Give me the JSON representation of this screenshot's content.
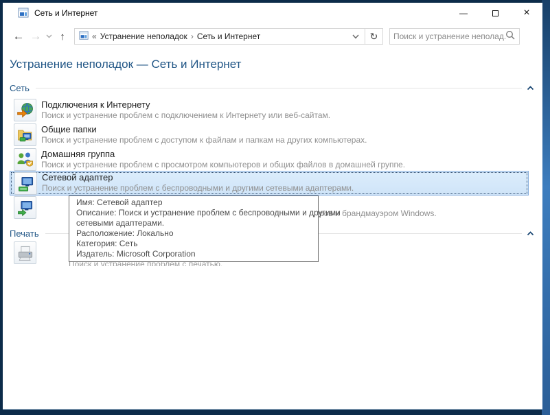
{
  "window": {
    "title": "Сеть и Интернет",
    "controls": {
      "minimize": "—",
      "close": "×"
    }
  },
  "navbar": {
    "back": "←",
    "forward": "→",
    "up": "↑",
    "refresh": "↻",
    "breadcrumb": {
      "collapse": "«",
      "separator": "›",
      "items": [
        "Устранение неполадок",
        "Сеть и Интернет"
      ]
    },
    "search_placeholder": "Поиск и устранение неполад..."
  },
  "page": {
    "title": "Устранение неполадок — Сеть и Интернет"
  },
  "sections": [
    {
      "label": "Сеть",
      "items": [
        {
          "title": "Подключения к Интернету",
          "description": "Поиск и устранение проблем с подключением к Интернету или веб-сайтам."
        },
        {
          "title": "Общие папки",
          "description": "Поиск и устранение проблем с доступом к файлам и папкам на других компьютерах."
        },
        {
          "title": "Домашняя группа",
          "description": "Поиск и устранение проблем с просмотром компьютеров и общих файлов в домашней группе."
        },
        {
          "title": "Сетевой адаптер",
          "description": "Поиск и устранение проблем с беспроводными и другими сетевыми адаптерами."
        },
        {
          "description_visible": "ров и брандмауэром Windows."
        }
      ]
    },
    {
      "label": "Печать",
      "items": [
        {
          "description_clipped": "Поиск и устранение проблем с печатью."
        }
      ]
    }
  ],
  "tooltip": {
    "lines": [
      "Имя: Сетевой адаптер",
      "Описание: Поиск и устранение проблем с беспроводными и другими",
      "сетевыми адаптерами.",
      "Расположение: Локально",
      "Категория: Сеть",
      "Издатель: Microsoft Corporation"
    ]
  }
}
